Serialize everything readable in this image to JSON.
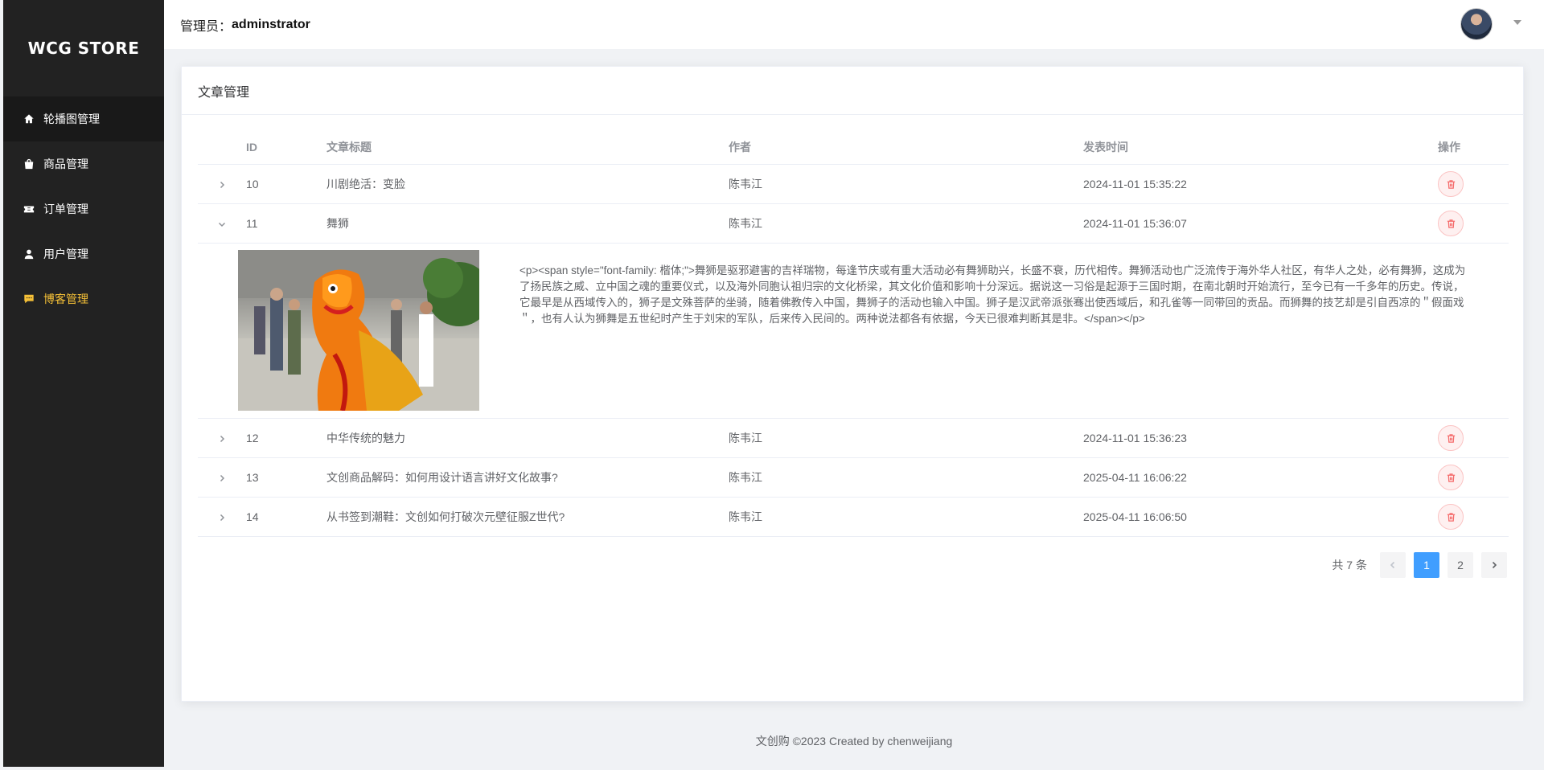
{
  "sidebar": {
    "logo": "WCG STORE",
    "items": [
      {
        "label": "轮播图管理",
        "icon": "home-icon"
      },
      {
        "label": "商品管理",
        "icon": "shopping-bag-icon"
      },
      {
        "label": "订单管理",
        "icon": "ticket-icon"
      },
      {
        "label": "用户管理",
        "icon": "user-icon"
      },
      {
        "label": "博客管理",
        "icon": "chat-icon"
      }
    ]
  },
  "header": {
    "admin_label": "管理员：",
    "admin_name": "adminstrator"
  },
  "card": {
    "title": "文章管理"
  },
  "table": {
    "columns": [
      "ID",
      "文章标题",
      "作者",
      "发表时间",
      "操作"
    ],
    "rows": [
      {
        "id": "10",
        "title": "川剧绝活：变脸",
        "author": "陈韦江",
        "time": "2024-11-01 15:35:22"
      },
      {
        "id": "11",
        "title": "舞狮",
        "author": "陈韦江",
        "time": "2024-11-01 15:36:07"
      },
      {
        "id": "12",
        "title": "中华传统的魅力",
        "author": "陈韦江",
        "time": "2024-11-01 15:36:23"
      },
      {
        "id": "13",
        "title": "文创商品解码：如何用设计语言讲好文化故事?",
        "author": "陈韦江",
        "time": "2025-04-11 16:06:22"
      },
      {
        "id": "14",
        "title": "从书签到潮鞋：文创如何打破次元壁征服Z世代?",
        "author": "陈韦江",
        "time": "2025-04-11 16:06:50"
      }
    ],
    "expanded": {
      "content": "<p><span style=\"font-family: 楷体;\">舞狮是驱邪避害的吉祥瑞物，每逢节庆或有重大活动必有舞狮助兴，长盛不衰，历代相传。舞狮活动也广泛流传于海外华人社区，有华人之处，必有舞狮，这成为了扬民族之威、立中国之魂的重要仪式，以及海外同胞认祖归宗的文化桥梁，其文化价值和影响十分深远。据说这一习俗是起源于三国时期，在南北朝时开始流行，至今已有一千多年的历史。传说，它最早是从西域传入的，狮子是文殊菩萨的坐骑，随着佛教传入中国，舞狮子的活动也输入中国。狮子是汉武帝派张骞出使西域后，和孔雀等一同带回的贡品。而狮舞的技艺却是引自西凉的＂假面戏＂，也有人认为狮舞是五世纪时产生于刘宋的军队，后来传入民间的。两种说法都各有依据，今天已很难判断其是非。</span></p>"
    }
  },
  "pagination": {
    "total": "共 7 条",
    "pages": [
      "1",
      "2"
    ],
    "current": "1"
  },
  "footer": {
    "text": "文创购 ©2023 Created by chenweijiang"
  }
}
